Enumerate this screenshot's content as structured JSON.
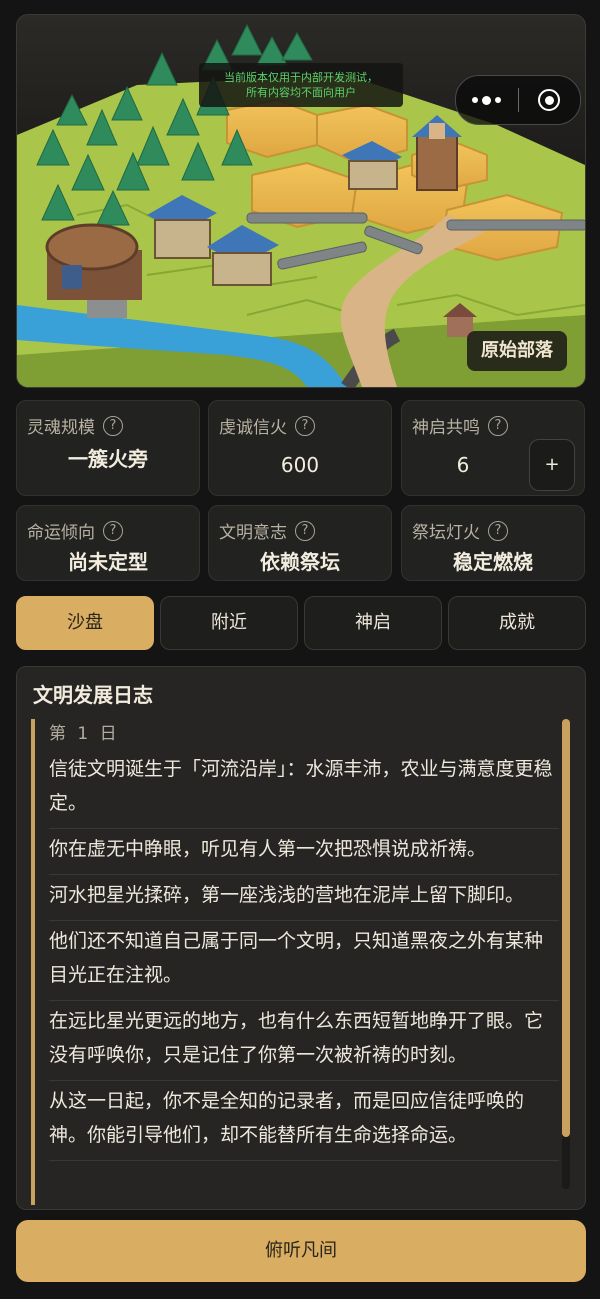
{
  "scene": {
    "notice_line1": "当前版本仅用于内部开发测试，",
    "notice_line2": "所有内容均不面向用户",
    "tribe_label": "原始部落"
  },
  "capsule": {
    "more_icon": "more-dots-icon",
    "close_icon": "target-close-icon"
  },
  "stats": {
    "soul_scale": {
      "label": "灵魂规模",
      "value": "一簇火旁"
    },
    "faith": {
      "label": "虔诚信火",
      "value": "600"
    },
    "revelation": {
      "label": "神启共鸣",
      "value": "6",
      "button": "+"
    },
    "fate": {
      "label": "命运倾向",
      "value": "尚未定型"
    },
    "civ_will": {
      "label": "文明意志",
      "value": "依赖祭坛"
    },
    "altar_fire": {
      "label": "祭坛灯火",
      "value": "稳定燃烧"
    },
    "help_glyph": "?"
  },
  "tabs": [
    {
      "label": "沙盘",
      "active": true
    },
    {
      "label": "附近",
      "active": false
    },
    {
      "label": "神启",
      "active": false
    },
    {
      "label": "成就",
      "active": false
    }
  ],
  "log": {
    "title": "文明发展日志",
    "day": "第 1 日",
    "entries": [
      "信徒文明诞生于「河流沿岸」：水源丰沛，农业与满意度更稳定。",
      "你在虚无中睁眼，听见有人第一次把恐惧说成祈祷。",
      "河水把星光揉碎，第一座浅浅的营地在泥岸上留下脚印。",
      "他们还不知道自己属于同一个文明，只知道黑夜之外有某种目光正在注视。",
      "在远比星光更远的地方，也有什么东西短暂地睁开了眼。它没有呼唤你，只是记住了你第一次被祈祷的时刻。",
      "从这一日起，你不是全知的记录者，而是回应信徒呼唤的神。你能引导他们，却不能替所有生命选择命运。"
    ]
  },
  "action": {
    "label": "俯听凡间"
  },
  "colors": {
    "accent": "#d9ad62",
    "background": "#141414",
    "card": "#222220"
  }
}
